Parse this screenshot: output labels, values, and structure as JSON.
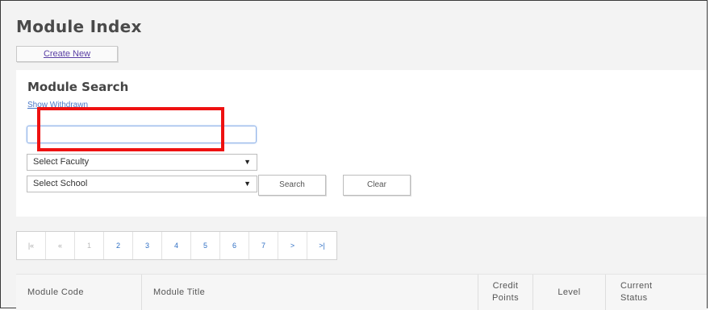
{
  "header": {
    "title": "Module Index",
    "create_label": "Create New"
  },
  "search": {
    "title": "Module Search",
    "withdrawn_link": "Show Withdrawn",
    "input_value": "",
    "faculty_select": "Select Faculty",
    "school_select": "Select School",
    "search_button": "Search",
    "clear_button": "Clear"
  },
  "pager": {
    "items": [
      "|«",
      "«",
      "1",
      "2",
      "3",
      "4",
      "5",
      "6",
      "7",
      ">",
      ">|"
    ],
    "current_page": "1"
  },
  "table": {
    "headers": [
      "Module Code",
      "Module Title",
      "Credit\nPoints",
      "Level",
      "Current\nStatus"
    ]
  },
  "colors": {
    "highlight": "#ee1111",
    "link": "#4a78c8",
    "input_focus_border": "#8fb2e8"
  }
}
